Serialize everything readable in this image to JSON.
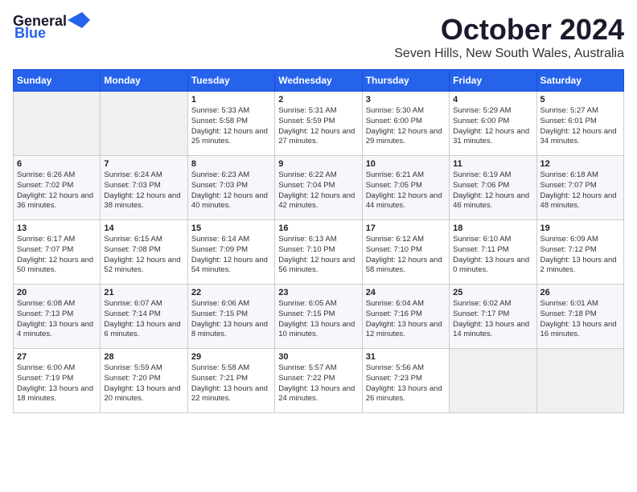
{
  "logo": {
    "general": "General",
    "blue": "Blue"
  },
  "title": "October 2024",
  "subtitle": "Seven Hills, New South Wales, Australia",
  "days_of_week": [
    "Sunday",
    "Monday",
    "Tuesday",
    "Wednesday",
    "Thursday",
    "Friday",
    "Saturday"
  ],
  "weeks": [
    [
      {
        "num": "",
        "empty": true
      },
      {
        "num": "",
        "empty": true
      },
      {
        "num": "1",
        "sunrise": "Sunrise: 5:33 AM",
        "sunset": "Sunset: 5:58 PM",
        "daylight": "Daylight: 12 hours and 25 minutes."
      },
      {
        "num": "2",
        "sunrise": "Sunrise: 5:31 AM",
        "sunset": "Sunset: 5:59 PM",
        "daylight": "Daylight: 12 hours and 27 minutes."
      },
      {
        "num": "3",
        "sunrise": "Sunrise: 5:30 AM",
        "sunset": "Sunset: 6:00 PM",
        "daylight": "Daylight: 12 hours and 29 minutes."
      },
      {
        "num": "4",
        "sunrise": "Sunrise: 5:29 AM",
        "sunset": "Sunset: 6:00 PM",
        "daylight": "Daylight: 12 hours and 31 minutes."
      },
      {
        "num": "5",
        "sunrise": "Sunrise: 5:27 AM",
        "sunset": "Sunset: 6:01 PM",
        "daylight": "Daylight: 12 hours and 34 minutes."
      }
    ],
    [
      {
        "num": "6",
        "sunrise": "Sunrise: 6:26 AM",
        "sunset": "Sunset: 7:02 PM",
        "daylight": "Daylight: 12 hours and 36 minutes."
      },
      {
        "num": "7",
        "sunrise": "Sunrise: 6:24 AM",
        "sunset": "Sunset: 7:03 PM",
        "daylight": "Daylight: 12 hours and 38 minutes."
      },
      {
        "num": "8",
        "sunrise": "Sunrise: 6:23 AM",
        "sunset": "Sunset: 7:03 PM",
        "daylight": "Daylight: 12 hours and 40 minutes."
      },
      {
        "num": "9",
        "sunrise": "Sunrise: 6:22 AM",
        "sunset": "Sunset: 7:04 PM",
        "daylight": "Daylight: 12 hours and 42 minutes."
      },
      {
        "num": "10",
        "sunrise": "Sunrise: 6:21 AM",
        "sunset": "Sunset: 7:05 PM",
        "daylight": "Daylight: 12 hours and 44 minutes."
      },
      {
        "num": "11",
        "sunrise": "Sunrise: 6:19 AM",
        "sunset": "Sunset: 7:06 PM",
        "daylight": "Daylight: 12 hours and 46 minutes."
      },
      {
        "num": "12",
        "sunrise": "Sunrise: 6:18 AM",
        "sunset": "Sunset: 7:07 PM",
        "daylight": "Daylight: 12 hours and 48 minutes."
      }
    ],
    [
      {
        "num": "13",
        "sunrise": "Sunrise: 6:17 AM",
        "sunset": "Sunset: 7:07 PM",
        "daylight": "Daylight: 12 hours and 50 minutes."
      },
      {
        "num": "14",
        "sunrise": "Sunrise: 6:15 AM",
        "sunset": "Sunset: 7:08 PM",
        "daylight": "Daylight: 12 hours and 52 minutes."
      },
      {
        "num": "15",
        "sunrise": "Sunrise: 6:14 AM",
        "sunset": "Sunset: 7:09 PM",
        "daylight": "Daylight: 12 hours and 54 minutes."
      },
      {
        "num": "16",
        "sunrise": "Sunrise: 6:13 AM",
        "sunset": "Sunset: 7:10 PM",
        "daylight": "Daylight: 12 hours and 56 minutes."
      },
      {
        "num": "17",
        "sunrise": "Sunrise: 6:12 AM",
        "sunset": "Sunset: 7:10 PM",
        "daylight": "Daylight: 12 hours and 58 minutes."
      },
      {
        "num": "18",
        "sunrise": "Sunrise: 6:10 AM",
        "sunset": "Sunset: 7:11 PM",
        "daylight": "Daylight: 13 hours and 0 minutes."
      },
      {
        "num": "19",
        "sunrise": "Sunrise: 6:09 AM",
        "sunset": "Sunset: 7:12 PM",
        "daylight": "Daylight: 13 hours and 2 minutes."
      }
    ],
    [
      {
        "num": "20",
        "sunrise": "Sunrise: 6:08 AM",
        "sunset": "Sunset: 7:13 PM",
        "daylight": "Daylight: 13 hours and 4 minutes."
      },
      {
        "num": "21",
        "sunrise": "Sunrise: 6:07 AM",
        "sunset": "Sunset: 7:14 PM",
        "daylight": "Daylight: 13 hours and 6 minutes."
      },
      {
        "num": "22",
        "sunrise": "Sunrise: 6:06 AM",
        "sunset": "Sunset: 7:15 PM",
        "daylight": "Daylight: 13 hours and 8 minutes."
      },
      {
        "num": "23",
        "sunrise": "Sunrise: 6:05 AM",
        "sunset": "Sunset: 7:15 PM",
        "daylight": "Daylight: 13 hours and 10 minutes."
      },
      {
        "num": "24",
        "sunrise": "Sunrise: 6:04 AM",
        "sunset": "Sunset: 7:16 PM",
        "daylight": "Daylight: 13 hours and 12 minutes."
      },
      {
        "num": "25",
        "sunrise": "Sunrise: 6:02 AM",
        "sunset": "Sunset: 7:17 PM",
        "daylight": "Daylight: 13 hours and 14 minutes."
      },
      {
        "num": "26",
        "sunrise": "Sunrise: 6:01 AM",
        "sunset": "Sunset: 7:18 PM",
        "daylight": "Daylight: 13 hours and 16 minutes."
      }
    ],
    [
      {
        "num": "27",
        "sunrise": "Sunrise: 6:00 AM",
        "sunset": "Sunset: 7:19 PM",
        "daylight": "Daylight: 13 hours and 18 minutes."
      },
      {
        "num": "28",
        "sunrise": "Sunrise: 5:59 AM",
        "sunset": "Sunset: 7:20 PM",
        "daylight": "Daylight: 13 hours and 20 minutes."
      },
      {
        "num": "29",
        "sunrise": "Sunrise: 5:58 AM",
        "sunset": "Sunset: 7:21 PM",
        "daylight": "Daylight: 13 hours and 22 minutes."
      },
      {
        "num": "30",
        "sunrise": "Sunrise: 5:57 AM",
        "sunset": "Sunset: 7:22 PM",
        "daylight": "Daylight: 13 hours and 24 minutes."
      },
      {
        "num": "31",
        "sunrise": "Sunrise: 5:56 AM",
        "sunset": "Sunset: 7:23 PM",
        "daylight": "Daylight: 13 hours and 26 minutes."
      },
      {
        "num": "",
        "empty": true
      },
      {
        "num": "",
        "empty": true
      }
    ]
  ]
}
